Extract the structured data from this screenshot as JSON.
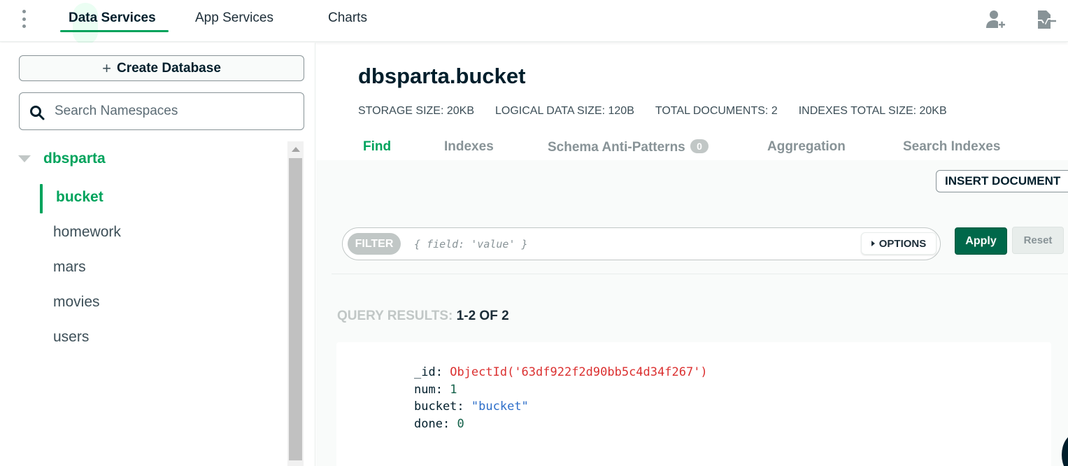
{
  "topnav": {
    "tabs": [
      {
        "label": "Data Services",
        "active": true
      },
      {
        "label": "App Services",
        "active": false
      },
      {
        "label": "Charts",
        "active": false
      }
    ],
    "icons": [
      "kebab-menu-icon",
      "invite-user-icon",
      "activity-feed-icon"
    ]
  },
  "sidebar": {
    "create_label": "Create Database",
    "search_placeholder": "Search Namespaces",
    "database": "dbsparta",
    "collections": [
      {
        "label": "bucket",
        "active": true
      },
      {
        "label": "homework",
        "active": false
      },
      {
        "label": "mars",
        "active": false
      },
      {
        "label": "movies",
        "active": false
      },
      {
        "label": "users",
        "active": false
      }
    ]
  },
  "main": {
    "namespace": "dbsparta.bucket",
    "stats": {
      "storage_size": "STORAGE SIZE: 20KB",
      "logical_size": "LOGICAL DATA SIZE: 120B",
      "total_documents": "TOTAL DOCUMENTS: 2",
      "indexes_size": "INDEXES TOTAL SIZE: 20KB"
    },
    "tabs": [
      {
        "label": "Find",
        "active": true
      },
      {
        "label": "Indexes",
        "active": false
      },
      {
        "label": "Schema Anti-Patterns",
        "badge": "0",
        "active": false
      },
      {
        "label": "Aggregation",
        "active": false
      },
      {
        "label": "Search Indexes",
        "active": false
      }
    ],
    "insert_label": "INSERT DOCUMENT",
    "filter": {
      "tag": "FILTER",
      "placeholder": "{ field: 'value' }",
      "options_label": "OPTIONS",
      "apply_label": "Apply",
      "reset_label": "Reset"
    },
    "results": {
      "label": "QUERY RESULTS:",
      "count": "1-2 OF 2"
    },
    "document": {
      "fields": [
        {
          "key": "_id:",
          "value": "ObjectId('63df922f2d90bb5c4d34f267')",
          "kind": "oid"
        },
        {
          "key": "num:",
          "value": "1",
          "kind": "num"
        },
        {
          "key": "bucket:",
          "value": "\"bucket\"",
          "kind": "str"
        },
        {
          "key": "done:",
          "value": "0",
          "kind": "num"
        }
      ]
    }
  },
  "colors": {
    "accent": "#00a35c",
    "apply": "#00684a",
    "text": "#001e2b"
  }
}
